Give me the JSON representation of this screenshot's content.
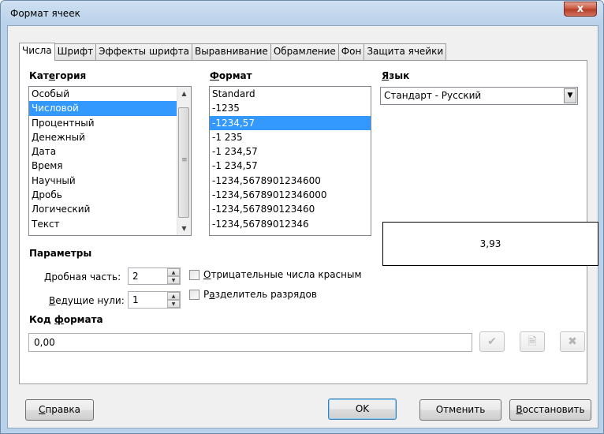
{
  "window": {
    "title": "Формат ячеек",
    "close_label": "x"
  },
  "tabs": [
    {
      "label": "Числа",
      "active": true
    },
    {
      "label": "Шрифт"
    },
    {
      "label": "Эффекты шрифта"
    },
    {
      "label": "Выравнивание"
    },
    {
      "label": "Обрамление"
    },
    {
      "label": "Фон"
    },
    {
      "label": "Защита ячейки"
    }
  ],
  "category": {
    "label_pre": "Кат",
    "label_u": "е",
    "label_post": "гория",
    "items": [
      "Особый",
      "Числовой",
      "Процентный",
      "Денежный",
      "Дата",
      "Время",
      "Научный",
      "Дробь",
      "Логический",
      "Текст"
    ],
    "selected_index": 1
  },
  "format": {
    "label_u": "Ф",
    "label_post": "ормат",
    "items": [
      "Standard",
      "-1235",
      "-1234,57",
      "-1 235",
      "-1 234,57",
      "-1 234,57",
      "-1234,5678901234600",
      "-1234,56789012346000",
      "-1234,567890123460",
      "-1234,56789012346"
    ],
    "selected_index": 2
  },
  "language": {
    "label_u": "Я",
    "label_post": "зык",
    "selected": "Стандарт - Русский"
  },
  "preview": {
    "value": "3,93"
  },
  "params": {
    "heading": "Параметры",
    "decimal_label_u": "Д",
    "decimal_label_post": "робная часть:",
    "decimal_value": "2",
    "leading_label_u": "В",
    "leading_label_post": "едущие нули:",
    "leading_value": "1",
    "negative_red_u": "О",
    "negative_red_post": "трицательные числа красным",
    "thousands_pre": "Р",
    "thousands_u": "а",
    "thousands_post": "зделитель разрядов"
  },
  "format_code": {
    "label_pre": "Код ",
    "label_u": "ф",
    "label_post": "ормата",
    "value": "0,00"
  },
  "icons": {
    "apply": "check-icon",
    "comment": "comment-icon",
    "delete": "delete-x-icon"
  },
  "buttons": {
    "help_u": "С",
    "help_post": "правка",
    "ok": "OK",
    "cancel": "Отменить",
    "reset_u": "В",
    "reset_post": "осстановить"
  }
}
